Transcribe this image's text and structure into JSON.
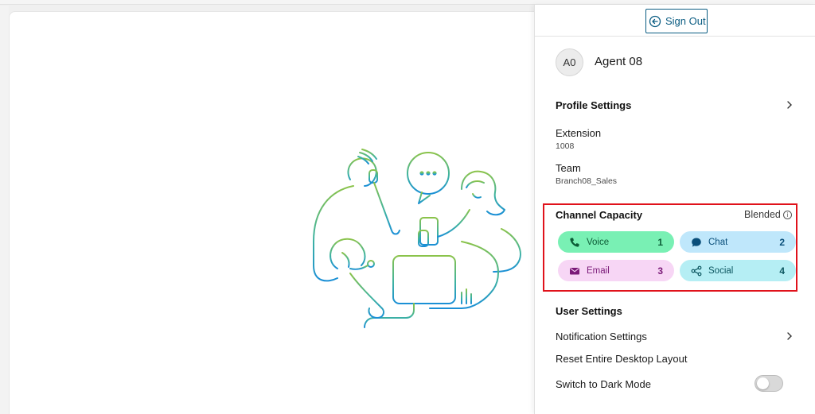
{
  "header": {
    "sign_out_label": "Sign Out"
  },
  "profile": {
    "initials": "A0",
    "name": "Agent 08"
  },
  "profile_settings": {
    "title": "Profile Settings",
    "extension_label": "Extension",
    "extension_value": "1008",
    "team_label": "Team",
    "team_value": "Branch08_Sales"
  },
  "channel_capacity": {
    "title": "Channel Capacity",
    "mode": "Blended",
    "channels": [
      {
        "label": "Voice",
        "count": "1",
        "icon": "phone-icon",
        "color": "#79f0b4"
      },
      {
        "label": "Chat",
        "count": "2",
        "icon": "chat-bubble-icon",
        "color": "#bfe7fb"
      },
      {
        "label": "Email",
        "count": "3",
        "icon": "envelope-icon",
        "color": "#f7d6f5"
      },
      {
        "label": "Social",
        "count": "4",
        "icon": "share-icon",
        "color": "#b5eef4"
      }
    ]
  },
  "user_settings": {
    "title": "User Settings",
    "notification_label": "Notification Settings",
    "reset_label": "Reset Entire Desktop Layout",
    "dark_mode_label": "Switch to Dark Mode",
    "dark_mode_enabled": false
  },
  "colors": {
    "accent": "#0a5c82",
    "highlight_border": "#e0121b"
  }
}
